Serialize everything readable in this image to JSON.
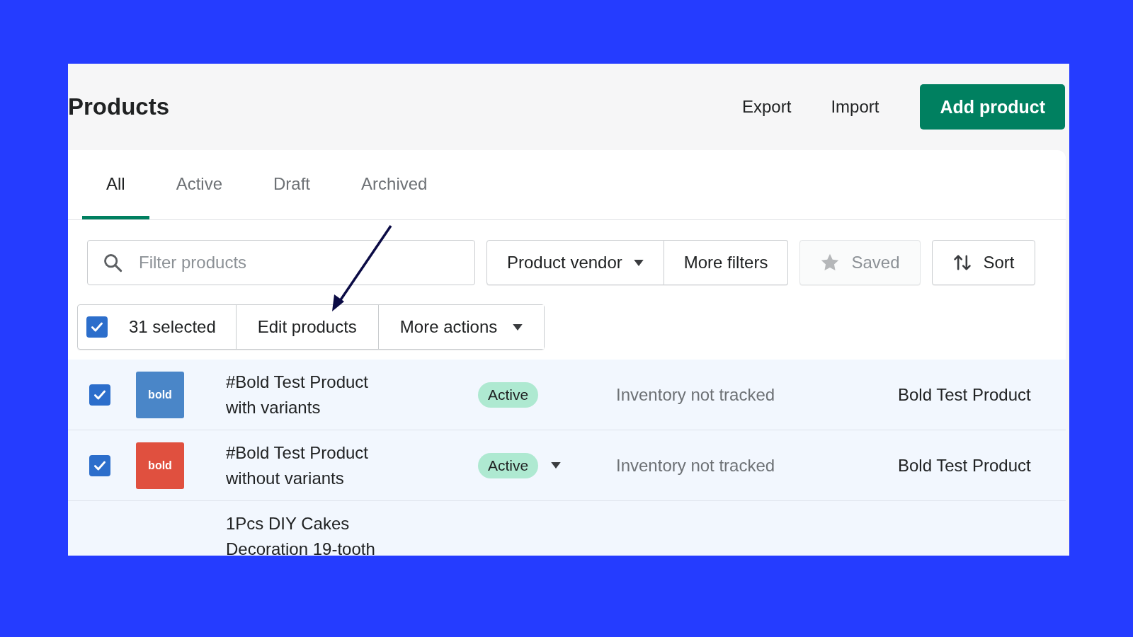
{
  "header": {
    "title": "Products",
    "actions": [
      "Export",
      "Import"
    ],
    "primary": "Add product"
  },
  "tabs": [
    {
      "label": "All",
      "selected": true
    },
    {
      "label": "Active",
      "selected": false
    },
    {
      "label": "Draft",
      "selected": false
    },
    {
      "label": "Archived",
      "selected": false
    }
  ],
  "filter": {
    "placeholder": "Filter products"
  },
  "filter_buttons": [
    {
      "kind": "dropdown",
      "label": "Product vendor",
      "disabled": false
    },
    {
      "kind": "plain",
      "label": "More filters",
      "disabled": false
    },
    {
      "kind": "star",
      "label": "Saved",
      "disabled": true
    },
    {
      "kind": "sort",
      "label": "Sort",
      "disabled": false
    }
  ],
  "bulk": {
    "checked": true,
    "count": "31 selected",
    "actions": [
      {
        "kind": "plain",
        "label": "Edit products"
      },
      {
        "kind": "dropdown",
        "label": "More actions"
      }
    ]
  },
  "rows": [
    {
      "checked": true,
      "thumb": {
        "label": "bold",
        "color": "#4a86c8"
      },
      "name": "#Bold Test Product with variants",
      "status": "Active",
      "status_menu": false,
      "inventory": "Inventory not tracked",
      "vendor": "Bold Test Product"
    },
    {
      "checked": true,
      "thumb": {
        "label": "bold",
        "color": "#e0503f"
      },
      "name": "#Bold Test Product without variants",
      "status": "Active",
      "status_menu": true,
      "inventory": "Inventory not tracked",
      "vendor": "Bold Test Product"
    },
    {
      "name": "1Pcs DIY Cakes Decoration 19-tooth"
    }
  ]
}
